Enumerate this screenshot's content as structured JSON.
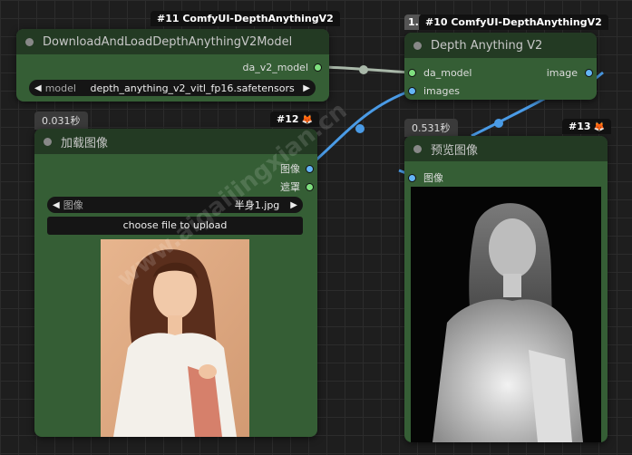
{
  "colors": {
    "canvas": "#1e1e1e",
    "node_body": "#355e35",
    "node_header": "#233a23",
    "socket_model": "#7fe07f",
    "socket_image": "#64b5f6",
    "wire_model": "#a9b8a9",
    "wire_image": "#4a9be6"
  },
  "nodes": {
    "download": {
      "id_badge": "#11 ComfyUI-DepthAnythingV2",
      "title": "DownloadAndLoadDepthAnythingV2Model",
      "output_label": "da_v2_model",
      "widget": {
        "label": "model",
        "value": "depth_anything_v2_vitl_fp16.safetensors"
      }
    },
    "depth": {
      "id_badge": "#10 ComfyUI-DepthAnythingV2",
      "badge_prefix": "1.",
      "title": "Depth Anything V2",
      "inputs": [
        "da_model",
        "images"
      ],
      "output_label": "image"
    },
    "load_image": {
      "timer": "0.031秒",
      "id_badge": "#12",
      "fox_icon": "fox-icon",
      "title": "加载图像",
      "outputs": [
        "图像",
        "遮罩"
      ],
      "widget": {
        "label": "图像",
        "value": "半身1.jpg"
      },
      "upload_label": "choose file to upload"
    },
    "preview": {
      "timer": "0.531秒",
      "id_badge": "#13",
      "fox_icon": "fox-icon",
      "title": "预览图像",
      "input_label": "图像"
    }
  },
  "watermark": "www.aigaijingxian.cn"
}
